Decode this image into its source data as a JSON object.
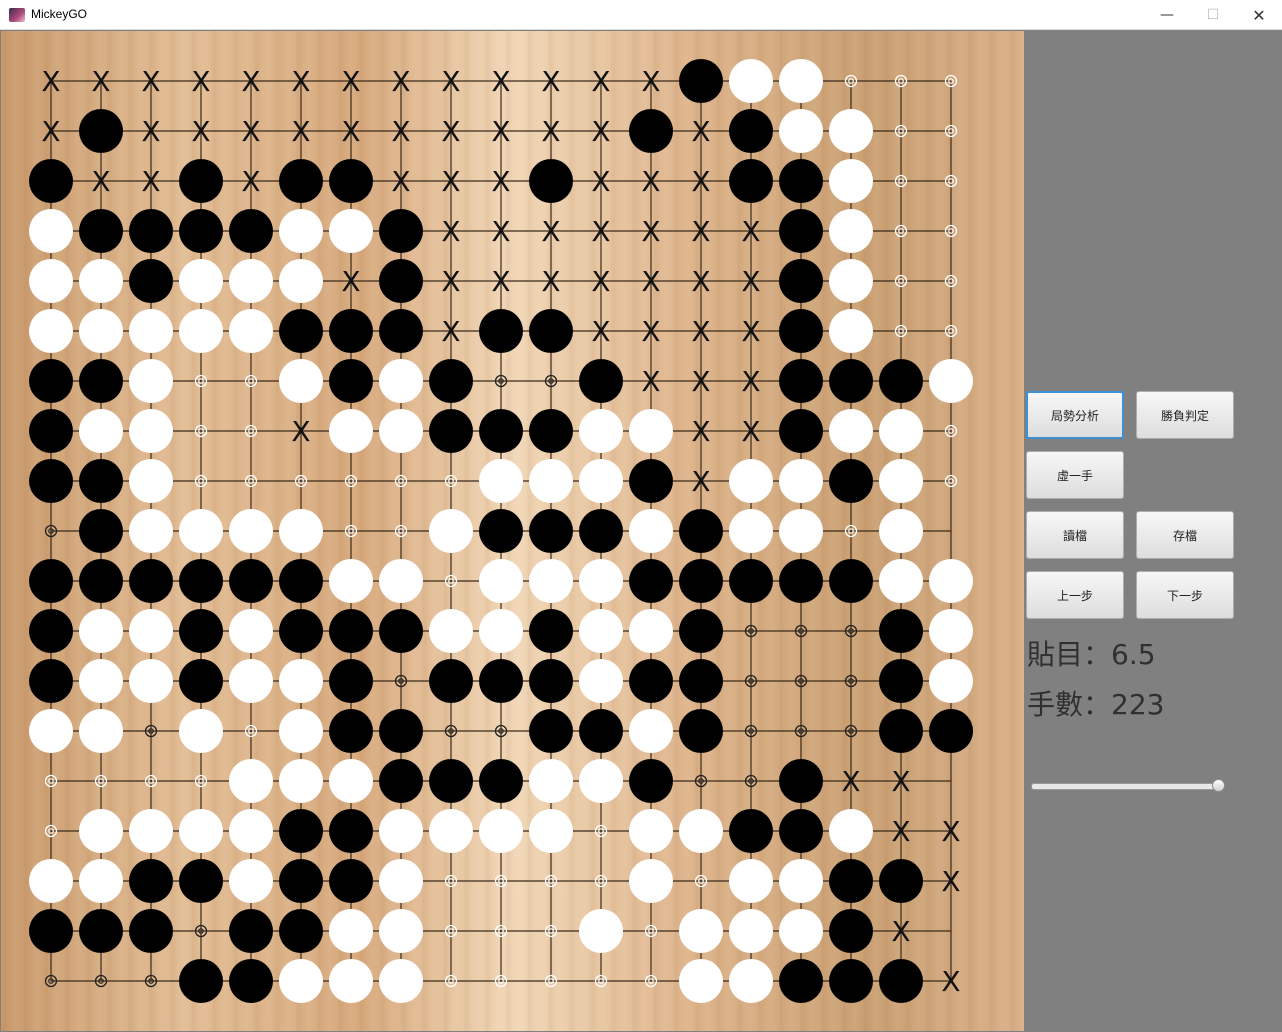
{
  "window": {
    "title": "MickeyGO",
    "minimize_icon": "—",
    "maximize_icon": "☐",
    "close_icon": "✕"
  },
  "board": {
    "size": 19,
    "legend": {
      "X": "black",
      "O": "white",
      "x": "cross-marker",
      "o": "small-ring-marker",
      "b": "small-ring-marker-dark"
    },
    "rows": [
      "xxxxxxxxxxxxxXOOooo",
      "xXxxxxxxxxxxXxXOOoo",
      "XxxXxXXxxxXxxxXXOoo",
      "OXXXXOOXxxxxxxxXOoo",
      "OOXOOOxXxxxxxxxXOoo",
      "OOOOOXXXxXXxxxxXOoo",
      "XXOooOXOXbbXxxxXXXO",
      "XOOooxOOXXXOOxxXOOo",
      "XXOooooooOOOXxOOXOoo",
      "bXOOOOooOXXXOXOOoO",
      "XXXXXXOOoOOOXXXXXOO",
      "XOOXOXXXOOXOOXbbbXO",
      "XOOXOOXbXXXOXXbbbXO",
      "OObOoOXXbbXXOXbbbXX",
      "ooooOOOXXXOOXbbXxx",
      "oOOOOXXOOOOoOOXXOxx",
      "OOXXOXXOooooOoOOXXx",
      "XXXbXXOOoooOoOOOXx",
      "bbbXXOOOoooooOOXXXx"
    ]
  },
  "controls": {
    "analysis": "局勢分析",
    "judge": "勝負判定",
    "pass": "虛一手",
    "load": "讀檔",
    "save": "存檔",
    "prev": "上一步",
    "next": "下一步"
  },
  "info": {
    "komi": "貼目：6.5",
    "moves": "手數：223"
  },
  "slider": {
    "value": 1.0
  }
}
